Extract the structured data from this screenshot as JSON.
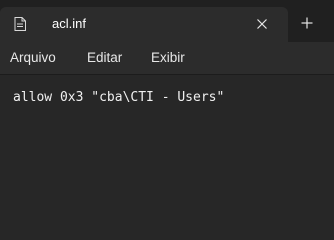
{
  "tab": {
    "title": "acl.inf",
    "icon": "document-icon",
    "close_icon": "close-icon",
    "new_tab_icon": "plus-icon"
  },
  "menu": {
    "items": [
      "Arquivo",
      "Editar",
      "Exibir"
    ]
  },
  "editor": {
    "lines": [
      "allow 0x3 \"cba\\CTI - Users\""
    ]
  },
  "colors": {
    "titlebar_bg": "#202020",
    "tab_bg": "#2c2c2c",
    "editor_bg": "#272727",
    "text": "#f0f0f0"
  }
}
